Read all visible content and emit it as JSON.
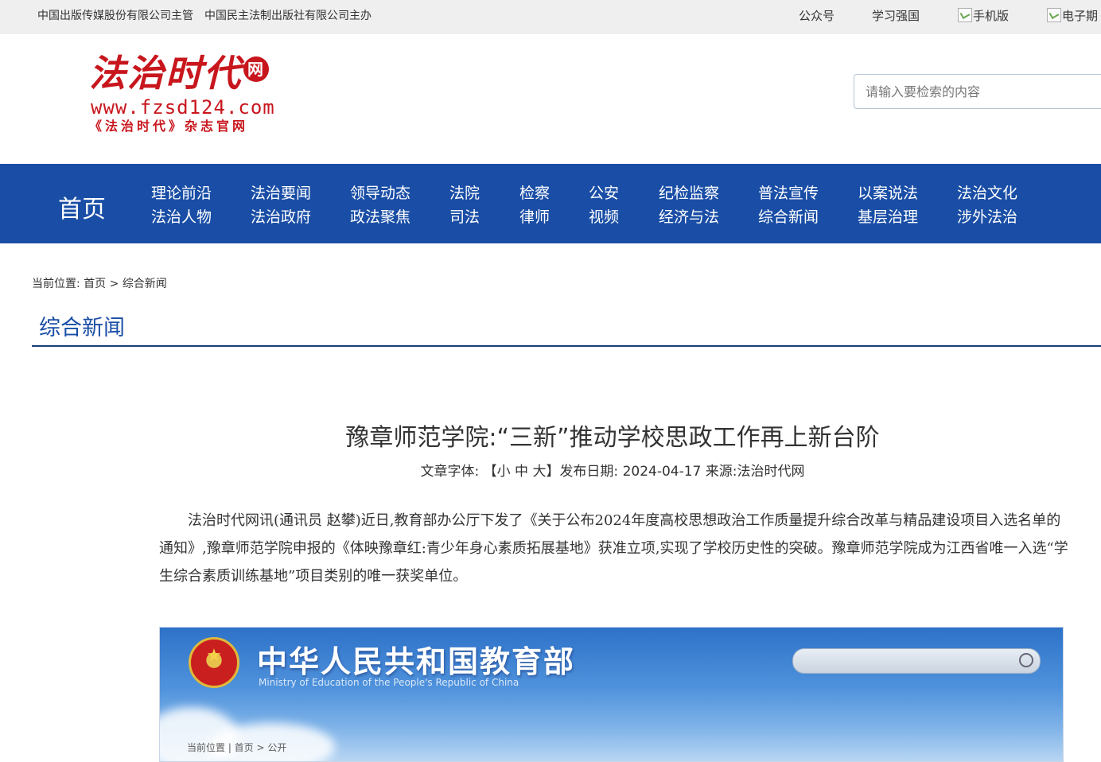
{
  "topbar": {
    "sponsor1": "中国出版传媒股份有限公司主管",
    "sponsor2": "中国民主法制出版社有限公司主办",
    "links": [
      "公众号",
      "学习强国",
      "手机版",
      "电子期"
    ]
  },
  "logo": {
    "brand": "法治时代",
    "badge": "网",
    "url": "www.fzsd124.com",
    "tagline": "《法治时代》杂志官网"
  },
  "search": {
    "placeholder": "请输入要检索的内容"
  },
  "nav": {
    "home": "首页",
    "columns": [
      [
        "理论前沿",
        "法治人物"
      ],
      [
        "法治要闻",
        "法治政府"
      ],
      [
        "领导动态",
        "政法聚焦"
      ],
      [
        "法院",
        "司法"
      ],
      [
        "检察",
        "律师"
      ],
      [
        "公安",
        "视频"
      ],
      [
        "纪检监察",
        "经济与法"
      ],
      [
        "普法宣传",
        "综合新闻"
      ],
      [
        "以案说法",
        "基层治理"
      ],
      [
        "法治文化",
        "涉外法治"
      ]
    ]
  },
  "breadcrumb": {
    "prefix": "当前位置:",
    "home": "首页",
    "sep": ">",
    "current": "综合新闻"
  },
  "section": {
    "title": "综合新闻"
  },
  "article": {
    "title": "豫章师范学院:“三新”推动学校思政工作再上新台阶",
    "font_label": "文章字体:",
    "font_open": "【",
    "font_small": "小",
    "font_medium": "中",
    "font_large": "大",
    "font_close": "】",
    "date_label": "发布日期:",
    "date": "2024-04-17",
    "source_label": "来源:",
    "source": "法治时代网",
    "paragraph": "法治时代网讯(通讯员 赵攀)近日,教育部办公厅下发了《关于公布2024年度高校思想政治工作质量提升综合改革与精品建设项目入选名单的通知》,豫章师范学院申报的《体映豫章红:青少年身心素质拓展基地》获准立项,实现了学校历史性的突破。豫章师范学院成为江西省唯一入选“学生综合素质训练基地”项目类别的唯一获奖单位。"
  },
  "ministry_image": {
    "name": "中华人民共和国教育部",
    "english": "Ministry of Education of the People's Republic of China",
    "crumb": "当前位置 | 首页 > 公开"
  }
}
